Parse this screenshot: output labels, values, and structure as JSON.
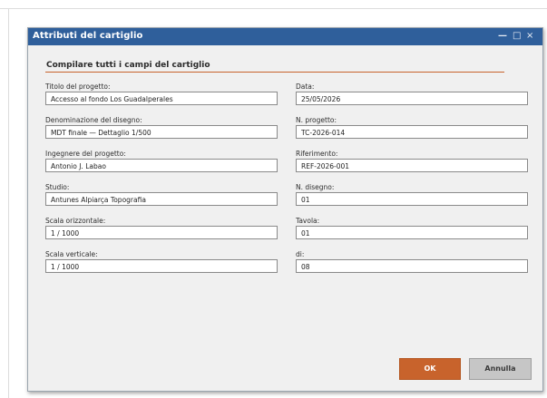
{
  "window": {
    "title": "Attributi del cartiglio",
    "controls": {
      "minimize": "—",
      "maximize": "□",
      "close": "×"
    }
  },
  "section": {
    "heading": "Compilare tutti i campi del cartiglio"
  },
  "fields": {
    "titolo": {
      "label": "Titolo del progetto:",
      "value": "Accesso al fondo Los Guadalperales"
    },
    "data": {
      "label": "Data:",
      "value": "25/05/2026"
    },
    "denominazione": {
      "label": "Denominazione del disegno:",
      "value": "MDT finale — Dettaglio 1/500"
    },
    "n_progetto": {
      "label": "N. progetto:",
      "value": "TC-2026-014"
    },
    "ingegnere": {
      "label": "Ingegnere del progetto:",
      "value": "Antonio J. Labao"
    },
    "riferimento": {
      "label": "Riferimento:",
      "value": "REF-2026-001"
    },
    "studio": {
      "label": "Studio:",
      "value": "Antunes Alpiarça Topografia"
    },
    "n_disegno": {
      "label": "N. disegno:",
      "value": "01"
    },
    "scala_orizzontale": {
      "label": "Scala orizzontale:",
      "value": "1 / 1000"
    },
    "tavola": {
      "label": "Tavola:",
      "value": "01"
    },
    "scala_verticale": {
      "label": "Scala verticale:",
      "value": "1 / 1000"
    },
    "di": {
      "label": "di:",
      "value": "08"
    }
  },
  "buttons": {
    "ok": "OK",
    "cancel": "Annulla"
  },
  "colors": {
    "titlebar": "#2f5f9b",
    "accent": "#c8632c",
    "dialog_background": "#f0f0f0",
    "cancel_button": "#c6c6c6"
  }
}
